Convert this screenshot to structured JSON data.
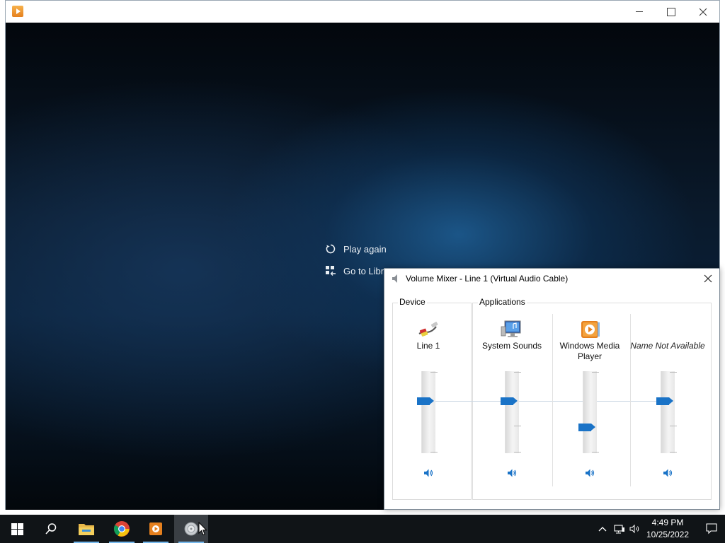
{
  "player": {
    "play_again": "Play again",
    "go_to_library": "Go to Libr"
  },
  "mixer": {
    "title": "Volume Mixer - Line 1 (Virtual Audio Cable)",
    "device_group": "Device",
    "applications_group": "Applications",
    "channels": [
      {
        "name": "Line 1",
        "icon": "audio-cable-icon",
        "volume_percent": 63
      },
      {
        "name": "System Sounds",
        "icon": "system-sounds-icon",
        "volume_percent": 63
      },
      {
        "name": "Windows Media Player",
        "icon": "media-player-icon",
        "volume_percent": 32
      },
      {
        "name": "Name Not Available",
        "icon": "none",
        "volume_percent": 63
      }
    ]
  },
  "taskbar": {
    "items": [
      "start-icon",
      "search-icon",
      "file-explorer-icon",
      "chrome-icon",
      "media-player-icon",
      "volume-mixer-icon"
    ],
    "time": "4:49 PM",
    "date": "10/25/2022"
  },
  "colors": {
    "accent": "#1a73c7",
    "taskbar": "#101417"
  }
}
